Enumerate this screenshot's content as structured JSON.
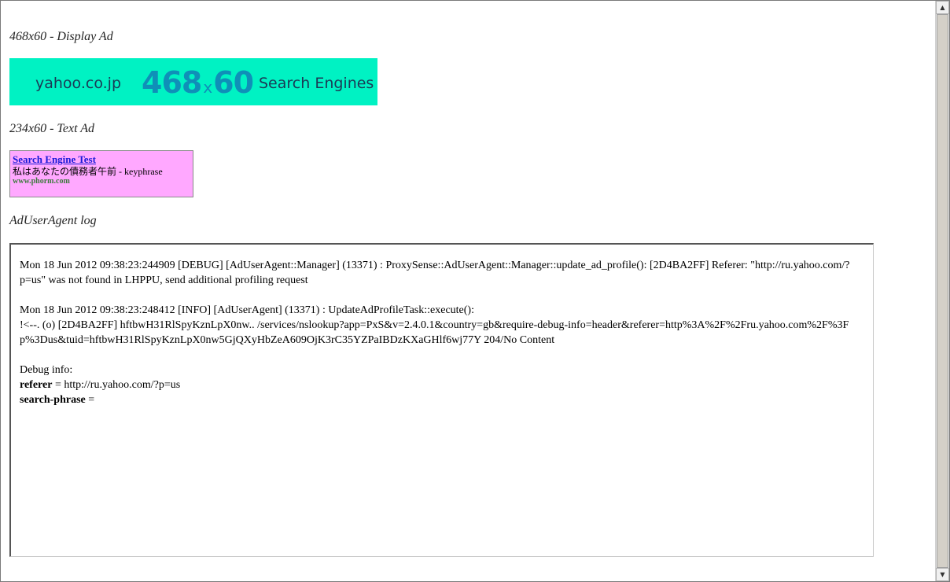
{
  "display_ad": {
    "heading": "468x60 - Display Ad",
    "site": "yahoo.co.jp",
    "size_w": "468",
    "size_x": "x",
    "size_h": "60",
    "category": "Search Engines"
  },
  "text_ad": {
    "heading": "234x60 - Text Ad",
    "headline": "Search Engine Test",
    "body": "私はあなたの債務者午前  - keyphrase",
    "url": "www.phorm.com"
  },
  "log": {
    "heading": "AdUserAgent log",
    "entries": [
      "Mon 18 Jun 2012 09:38:23:244909 [DEBUG] [AdUserAgent::Manager] (13371) : ProxySense::AdUserAgent::Manager::update_ad_profile(): [2D4BA2FF] Referer: \"http://ru.yahoo.com/?p=us\" was not found in LHPPU, send additional profiling request",
      "Mon 18 Jun 2012 09:38:23:248412 [INFO] [AdUserAgent] (13371) : UpdateAdProfileTask::execute():\n!<--. (o) [2D4BA2FF] hftbwH31RlSpyKznLpX0nw.. /services/nslookup?app=PxS&v=2.4.0.1&country=gb&require-debug-info=header&referer=http%3A%2F%2Fru.yahoo.com%2F%3Fp%3Dus&tuid=hftbwH31RlSpyKznLpX0nw5GjQXyHbZeA609OjK3rC35YZPaIBDzKXaGHlf6wj77Y 204/No Content"
    ],
    "debug_info_label": "Debug info:",
    "debug": [
      {
        "key": "referer",
        "value": " = http://ru.yahoo.com/?p=us"
      },
      {
        "key": "search-phrase",
        "value": " ="
      }
    ]
  },
  "scrollbar": {
    "up_arrow": "▲",
    "down_arrow": "▼"
  }
}
